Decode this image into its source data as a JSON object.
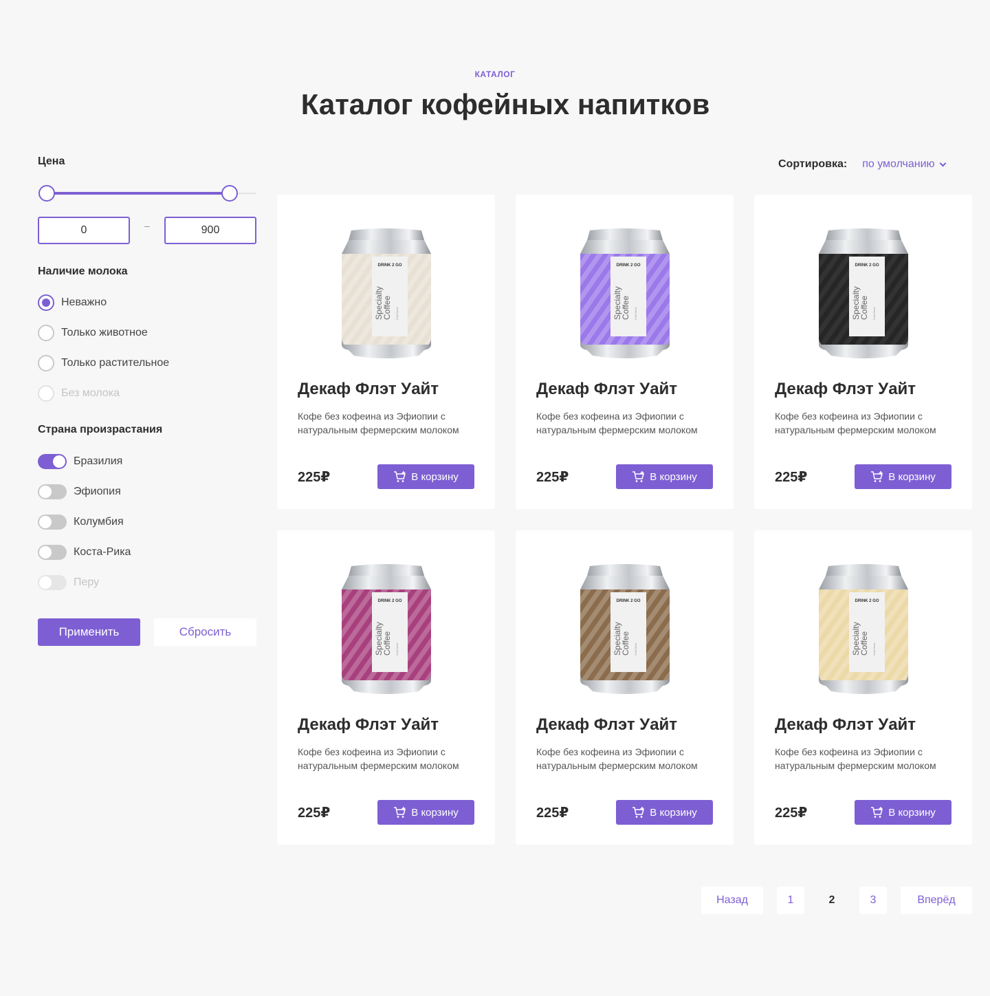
{
  "header": {
    "eyebrow": "КАТАЛОГ",
    "title": "Каталог кофейных напитков"
  },
  "filters": {
    "price": {
      "label": "Цена",
      "min_value": "0",
      "max_value": "900",
      "range_fill_fraction": 0.86
    },
    "milk": {
      "label": "Наличие молока",
      "options": [
        {
          "label": "Неважно",
          "checked": true,
          "disabled": false
        },
        {
          "label": "Только животное",
          "checked": false,
          "disabled": false
        },
        {
          "label": "Только растительное",
          "checked": false,
          "disabled": false
        },
        {
          "label": "Без молока",
          "checked": false,
          "disabled": true
        }
      ]
    },
    "country": {
      "label": "Страна произрастания",
      "options": [
        {
          "label": "Бразилия",
          "on": true,
          "disabled": false
        },
        {
          "label": "Эфиопия",
          "on": false,
          "disabled": false
        },
        {
          "label": "Колумбия",
          "on": false,
          "disabled": false
        },
        {
          "label": "Коста-Рика",
          "on": false,
          "disabled": false
        },
        {
          "label": "Перу",
          "on": false,
          "disabled": true
        }
      ]
    },
    "apply_label": "Применить",
    "reset_label": "Сбросить"
  },
  "sort": {
    "label": "Сортировка:",
    "value": "по умолчанию"
  },
  "products": [
    {
      "title": "Декаф Флэт Уайт",
      "description": "Кофе без кофеина из Эфиопии с натуральным фермерским молоком",
      "price": "225₽",
      "button": "В корзину",
      "can_color": "#e8e0d4",
      "can_label": "Specialty Coffee",
      "brand": "DRINK 2 GO"
    },
    {
      "title": "Декаф Флэт Уайт",
      "description": "Кофе без кофеина из Эфиопии с натуральным фермерским молоком",
      "price": "225₽",
      "button": "В корзину",
      "can_color": "#9b79ea",
      "can_label": "Specialty Coffee",
      "brand": "DRINK 2 GO"
    },
    {
      "title": "Декаф Флэт Уайт",
      "description": "Кофе без кофеина из Эфиопии с натуральным фермерским молоком",
      "price": "225₽",
      "button": "В корзину",
      "can_color": "#262626",
      "can_label": "Specialty Coffee",
      "brand": "DRINK 2 GO"
    },
    {
      "title": "Декаф Флэт Уайт",
      "description": "Кофе без кофеина из Эфиопии с натуральным фермерским молоком",
      "price": "225₽",
      "button": "В корзину",
      "can_color": "#a8407e",
      "can_label": "Specialty Coffee",
      "brand": "DRINK 2 GO"
    },
    {
      "title": "Декаф Флэт Уайт",
      "description": "Кофе без кофеина из Эфиопии с натуральным фермерским молоком",
      "price": "225₽",
      "button": "В корзину",
      "can_color": "#8b6c4c",
      "can_label": "Specialty Coffee",
      "brand": "DRINK 2 GO"
    },
    {
      "title": "Декаф Флэт Уайт",
      "description": "Кофе без кофеина из Эфиопии с натуральным фермерским молоком",
      "price": "225₽",
      "button": "В корзину",
      "can_color": "#ecd9a8",
      "can_label": "Specialty Coffee",
      "brand": "DRINK 2 GO"
    }
  ],
  "pagination": {
    "prev_label": "Назад",
    "pages": [
      "1",
      "2",
      "3"
    ],
    "current": "2",
    "next_label": "Вперёд"
  },
  "colors": {
    "accent": "#7d5fd3",
    "background": "#f7f7f7",
    "card": "#ffffff"
  }
}
